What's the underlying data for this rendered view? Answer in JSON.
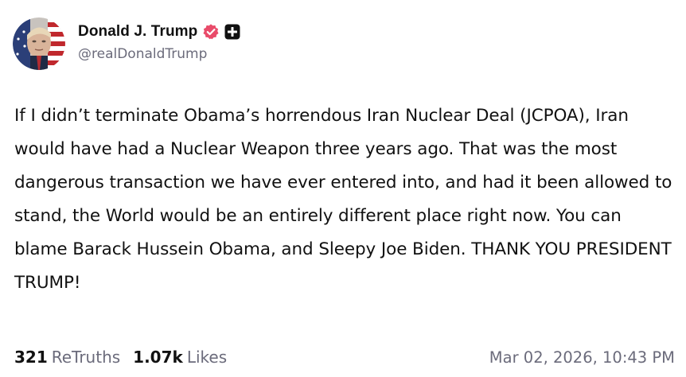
{
  "author": {
    "display_name": "Donald J. Trump",
    "handle": "@realDonaldTrump",
    "verified_color": "#e94b6a"
  },
  "icons": {
    "avatar": "profile-avatar",
    "verified": "verified-badge-icon",
    "plus": "plus-badge-icon"
  },
  "post": {
    "text": "If I didn’t terminate Obama’s horrendous Iran Nuclear Deal (JCPOA), Iran would have had a Nuclear Weapon three years ago. That was the most dangerous transaction we have ever entered into, and had it been allowed to stand, the World would be an entirely different place right now. You can blame Barack Hussein Obama, and Sleepy Joe Biden. THANK YOU PRESIDENT TRUMP!"
  },
  "stats": {
    "retruths_count": "321",
    "retruths_label": "ReTruths",
    "likes_count": "1.07k",
    "likes_label": "Likes"
  },
  "timestamp": "Mar 02, 2026, 10:43 PM"
}
